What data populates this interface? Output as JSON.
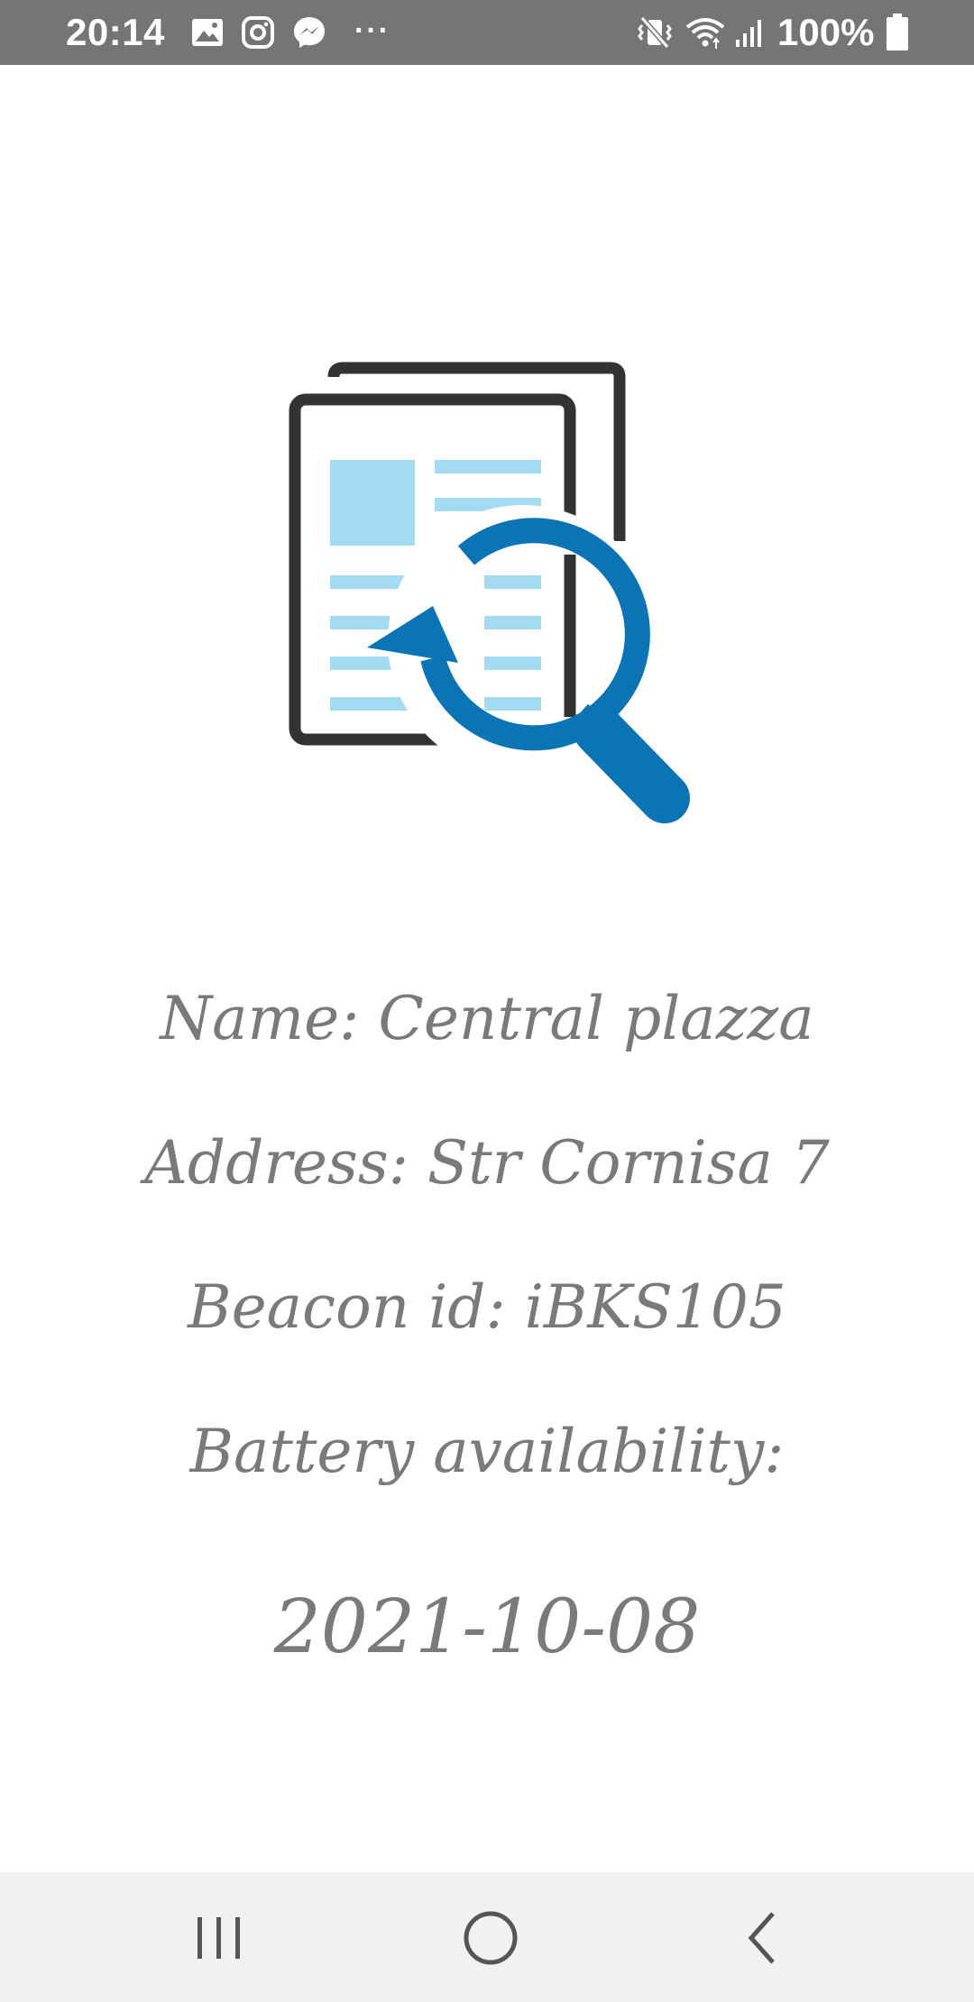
{
  "status_bar": {
    "time": "20:14",
    "icons": [
      "gallery-icon",
      "instagram-icon",
      "messenger-icon",
      "overflow-dots-icon",
      "vibrate-icon",
      "wifi-icon",
      "signal-icon",
      "battery-icon"
    ],
    "overflow": "···",
    "battery_percent": "100%"
  },
  "content": {
    "illustration_icon": "document-search-refresh-icon",
    "name": "Name: Central plazza",
    "address": "Address: Str Cornisa 7",
    "beacon_id": "Beacon id: iBKS105",
    "battery": "Battery availability:",
    "date": "2021-10-08"
  },
  "colors": {
    "status_bar_bg": "#757575",
    "text_gray": "#7a7a7a",
    "accent_blue": "#0a74b5",
    "light_blue": "#a3dbf5",
    "doc_outline": "#333333",
    "nav_bar_bg": "#f1f1f1"
  },
  "nav_bar": {
    "icons": [
      "recents-icon",
      "home-icon",
      "back-icon"
    ]
  }
}
